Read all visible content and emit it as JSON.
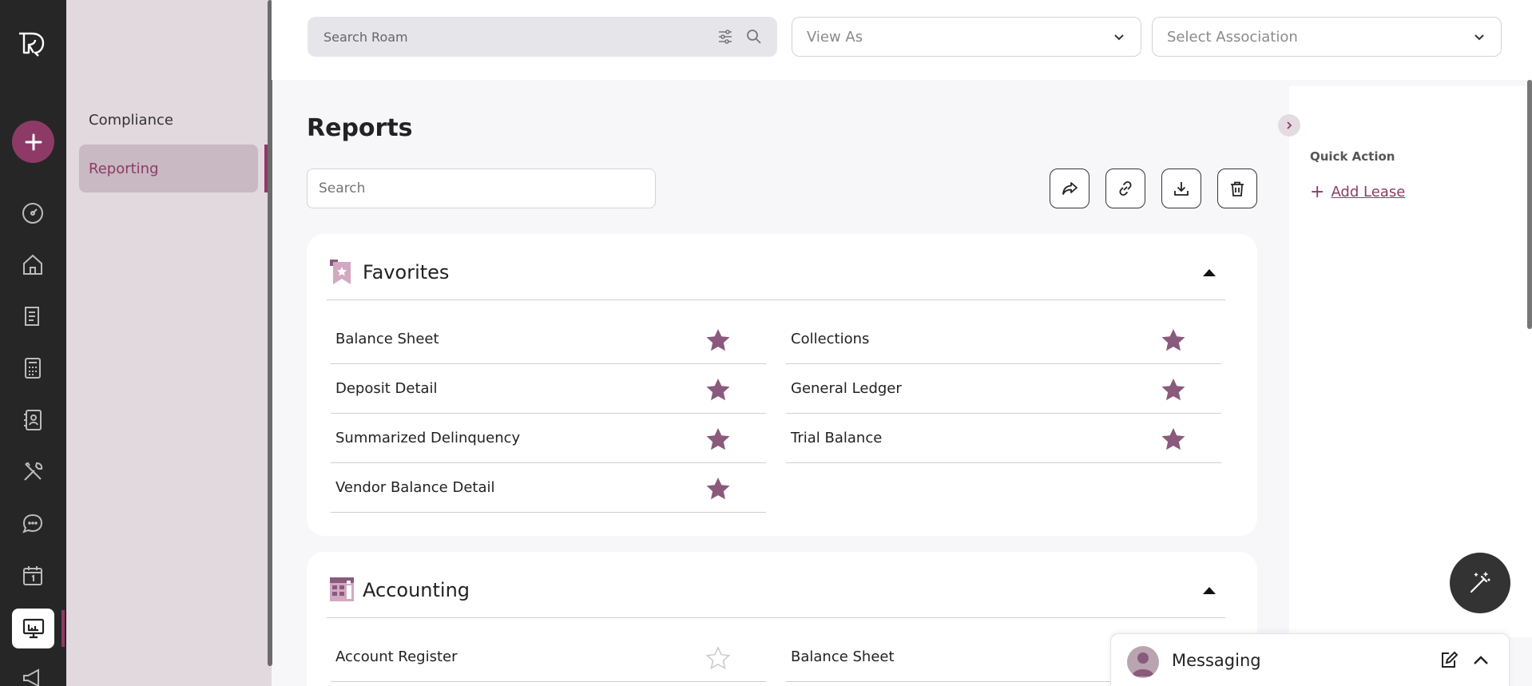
{
  "sidebar": {
    "items": [
      {
        "label": "Compliance"
      },
      {
        "label": "Reporting"
      }
    ]
  },
  "topbar": {
    "search_placeholder": "Search Roam",
    "view_as": "View As",
    "association": "Select Association"
  },
  "page": {
    "title": "Reports",
    "search_placeholder": "Search"
  },
  "favorites": {
    "title": "Favorites",
    "left": [
      {
        "label": "Balance Sheet",
        "starred": true
      },
      {
        "label": "Deposit Detail",
        "starred": true
      },
      {
        "label": "Summarized Delinquency",
        "starred": true
      },
      {
        "label": "Vendor Balance Detail",
        "starred": true
      }
    ],
    "right": [
      {
        "label": "Collections",
        "starred": true
      },
      {
        "label": "General Ledger",
        "starred": true
      },
      {
        "label": "Trial Balance",
        "starred": true
      }
    ]
  },
  "accounting": {
    "title": "Accounting",
    "left": [
      {
        "label": "Account Register",
        "starred": false
      }
    ],
    "right": [
      {
        "label": "Balance Sheet",
        "starred": false
      }
    ]
  },
  "quick_action": {
    "title": "Quick Action",
    "add_lease": "Add Lease"
  },
  "messaging": {
    "label": "Messaging"
  },
  "colors": {
    "accent": "#8e3a66",
    "star_fill": "#8a5a7d",
    "rail": "#262626"
  }
}
